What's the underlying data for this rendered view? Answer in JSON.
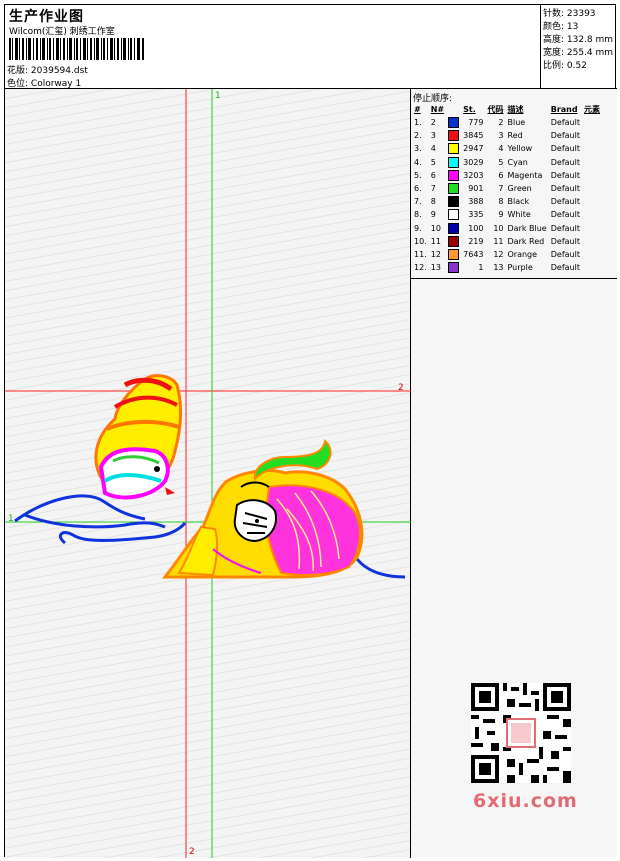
{
  "header": {
    "title": "生产作业图",
    "company": "Wilcom(汇玺) 刺绣工作室",
    "design_label": "花版:",
    "design_value": "2039594.dst",
    "colorway_label": "色位:",
    "colorway_value": "Colorway 1"
  },
  "stats": {
    "stitches": "针数: 23393",
    "colors": "颜色: 13",
    "height": "高度: 132.8 mm",
    "width": "宽度: 255.4 mm",
    "scale": "比例: 0.52"
  },
  "stop_sequence": {
    "title": "停止顺序:",
    "headers": [
      "#",
      "N#",
      "St.",
      "代码",
      "描述",
      "Brand",
      "元素"
    ],
    "rows": [
      {
        "no": "1.",
        "n": "2",
        "st": "779",
        "code": "2",
        "desc": "Blue",
        "brand": "Default",
        "color": "#0033cc"
      },
      {
        "no": "2.",
        "n": "3",
        "st": "3845",
        "code": "3",
        "desc": "Red",
        "brand": "Default",
        "color": "#ee1111"
      },
      {
        "no": "3.",
        "n": "4",
        "st": "2947",
        "code": "4",
        "desc": "Yellow",
        "brand": "Default",
        "color": "#ffff00"
      },
      {
        "no": "4.",
        "n": "5",
        "st": "3029",
        "code": "5",
        "desc": "Cyan",
        "brand": "Default",
        "color": "#00ffff"
      },
      {
        "no": "5.",
        "n": "6",
        "st": "3203",
        "code": "6",
        "desc": "Magenta",
        "brand": "Default",
        "color": "#ff00ff"
      },
      {
        "no": "6.",
        "n": "7",
        "st": "901",
        "code": "7",
        "desc": "Green",
        "brand": "Default",
        "color": "#22dd22"
      },
      {
        "no": "7.",
        "n": "8",
        "st": "388",
        "code": "8",
        "desc": "Black",
        "brand": "Default",
        "color": "#000000"
      },
      {
        "no": "8.",
        "n": "9",
        "st": "335",
        "code": "9",
        "desc": "White",
        "brand": "Default",
        "color": "#ffffff"
      },
      {
        "no": "9.",
        "n": "10",
        "st": "100",
        "code": "10",
        "desc": "Dark Blue",
        "brand": "Default",
        "color": "#0000aa"
      },
      {
        "no": "10.",
        "n": "11",
        "st": "219",
        "code": "11",
        "desc": "Dark Red",
        "brand": "Default",
        "color": "#990000"
      },
      {
        "no": "11.",
        "n": "12",
        "st": "7643",
        "code": "12",
        "desc": "Orange",
        "brand": "Default",
        "color": "#ff9933"
      },
      {
        "no": "12.",
        "n": "13",
        "st": "1",
        "code": "13",
        "desc": "Purple",
        "brand": "Default",
        "color": "#8833cc"
      }
    ]
  },
  "markers": {
    "green_top": "1",
    "green_left": "1",
    "red_right": "2",
    "red_bottom": "2"
  },
  "watermark": {
    "site": "6xiu.com",
    "qr_label": "QR code"
  }
}
